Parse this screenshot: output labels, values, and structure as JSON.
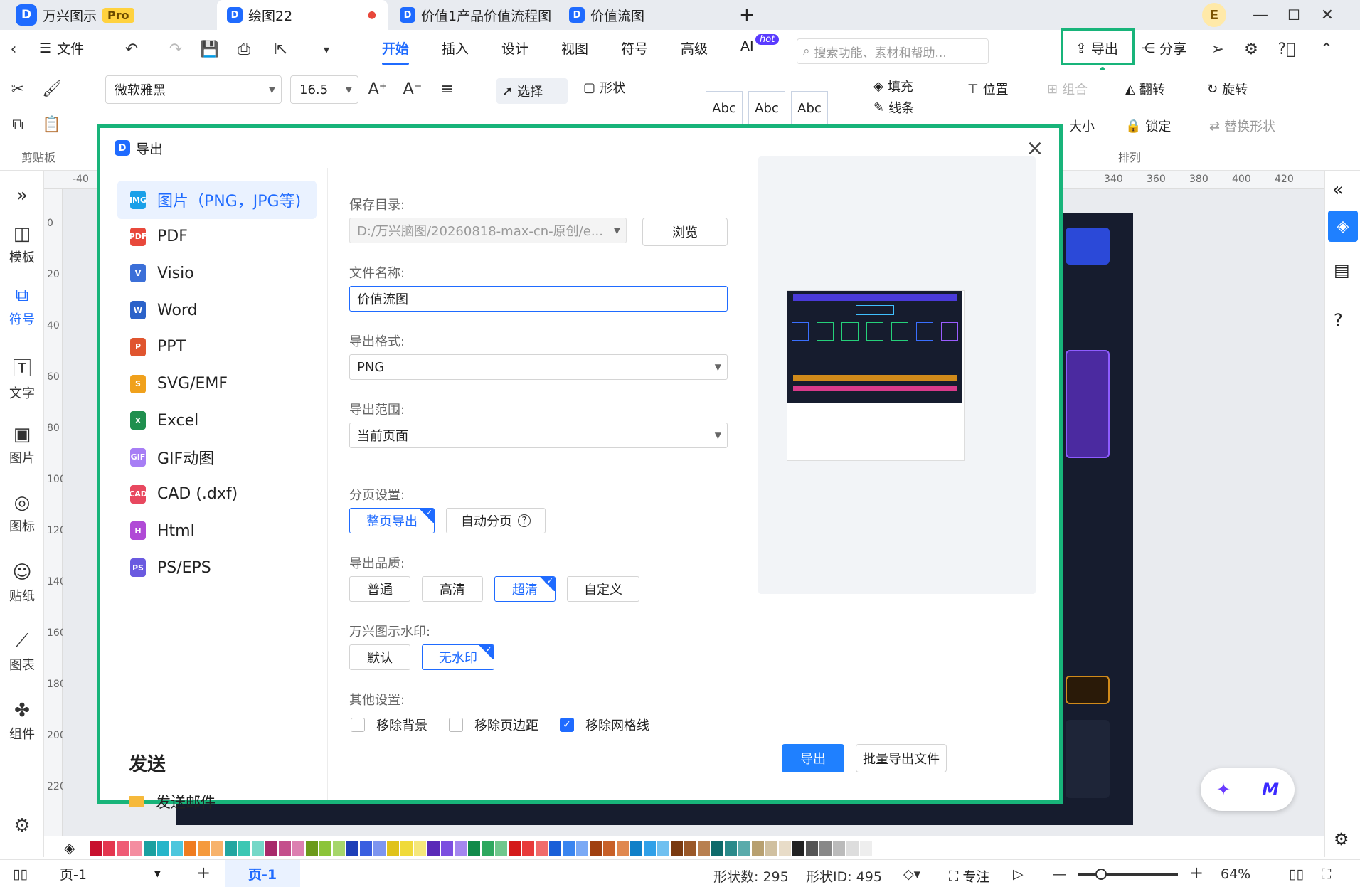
{
  "titlebar": {
    "app_name": "万兴图示",
    "pro_badge": "Pro",
    "tabs": [
      {
        "label": "绘图22"
      },
      {
        "label": "价值1产品价值流程图"
      },
      {
        "label": "价值流图"
      }
    ],
    "new_tab": "+",
    "user_initial": "E"
  },
  "menubar": {
    "file": "文件",
    "menus": [
      "开始",
      "插入",
      "设计",
      "视图",
      "符号",
      "高级",
      "AI"
    ],
    "hot_badge": "hot",
    "search_placeholder": "搜索功能、素材和帮助...",
    "export": "导出",
    "share": "分享"
  },
  "ribbon": {
    "font_name": "微软雅黑",
    "font_size": "16.5",
    "select": "选择",
    "shape": "形状",
    "style_samples": [
      "Abc",
      "Abc",
      "Abc"
    ],
    "fill": "填充",
    "line": "线条",
    "position": "位置",
    "group": "组合",
    "flip": "翻转",
    "rotate": "旋转",
    "size": "大小",
    "lock": "锁定",
    "replace_shape": "替换形状",
    "clipboard_label": "剪贴板",
    "arrange_label": "排列"
  },
  "leftbar": {
    "items": [
      {
        "label": "模板"
      },
      {
        "label": "符号"
      },
      {
        "label": "文字"
      },
      {
        "label": "图片"
      },
      {
        "label": "图标"
      },
      {
        "label": "贴纸"
      },
      {
        "label": "图表"
      },
      {
        "label": "组件"
      }
    ]
  },
  "ruler": {
    "h": [
      "-40",
      "340",
      "360",
      "380",
      "400",
      "420"
    ],
    "v": [
      "0",
      "20",
      "40",
      "60",
      "80",
      "100",
      "120",
      "140",
      "160",
      "180",
      "200",
      "220"
    ]
  },
  "dialog": {
    "title": "导出",
    "formats": [
      {
        "label": "图片（PNG，JPG等)",
        "icon": "image",
        "color": "#1aa0e8"
      },
      {
        "label": "PDF",
        "icon": "pdf",
        "color": "#e8483b"
      },
      {
        "label": "Visio",
        "icon": "visio",
        "color": "#3b6fd8"
      },
      {
        "label": "Word",
        "icon": "word",
        "color": "#2b62c9"
      },
      {
        "label": "PPT",
        "icon": "ppt",
        "color": "#e0552f"
      },
      {
        "label": "SVG/EMF",
        "icon": "svg",
        "color": "#f0a11c"
      },
      {
        "label": "Excel",
        "icon": "excel",
        "color": "#1f8f4e"
      },
      {
        "label": "GIF动图",
        "icon": "gif",
        "color": "#a77ef5"
      },
      {
        "label": "CAD (.dxf)",
        "icon": "cad",
        "color": "#e8485f"
      },
      {
        "label": "Html",
        "icon": "html",
        "color": "#b04ad6"
      },
      {
        "label": "PS/EPS",
        "icon": "ps",
        "color": "#6a5ae0"
      }
    ],
    "send_heading": "发送",
    "send_email": "发送邮件",
    "save_dir_label": "保存目录:",
    "save_dir_value": "D:/万兴脑图/20260818-max-cn-原创/e...",
    "browse": "浏览",
    "file_name_label": "文件名称:",
    "file_name_value": "价值流图",
    "format_label": "导出格式:",
    "format_value": "PNG",
    "range_label": "导出范围:",
    "range_value": "当前页面",
    "pagination_label": "分页设置:",
    "pagination_opts": [
      "整页导出",
      "自动分页"
    ],
    "quality_label": "导出品质:",
    "quality_opts": [
      "普通",
      "高清",
      "超清",
      "自定义"
    ],
    "watermark_label": "万兴图示水印:",
    "watermark_opts": [
      "默认",
      "无水印"
    ],
    "other_label": "其他设置:",
    "other_opts": [
      {
        "label": "移除背景",
        "checked": false
      },
      {
        "label": "移除页边距",
        "checked": false
      },
      {
        "label": "移除网格线",
        "checked": true
      }
    ],
    "export_btn": "导出",
    "batch_btn": "批量导出文件"
  },
  "status": {
    "page_select": "页-1",
    "page_tab": "页-1",
    "shape_count": "形状数: 295",
    "shape_id": "形状ID: 495",
    "focus": "专注",
    "zoom": "64%"
  },
  "colors": {
    "accent": "#1f6bff",
    "highlight": "#18b47a"
  }
}
